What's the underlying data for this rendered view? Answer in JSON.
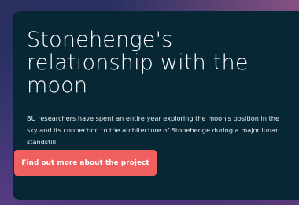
{
  "hero": {
    "title": "Stonehenge's relationship with the moon",
    "description": "BU researchers have spent an entire year exploring the moon's position in the sky and its connection to the architecture of Stonehenge during a major lunar standstill.",
    "cta_label": "Find out more about the project"
  },
  "colors": {
    "card_background": "#082735",
    "cta_background": "#f06060",
    "title_text": "#ffffff"
  }
}
